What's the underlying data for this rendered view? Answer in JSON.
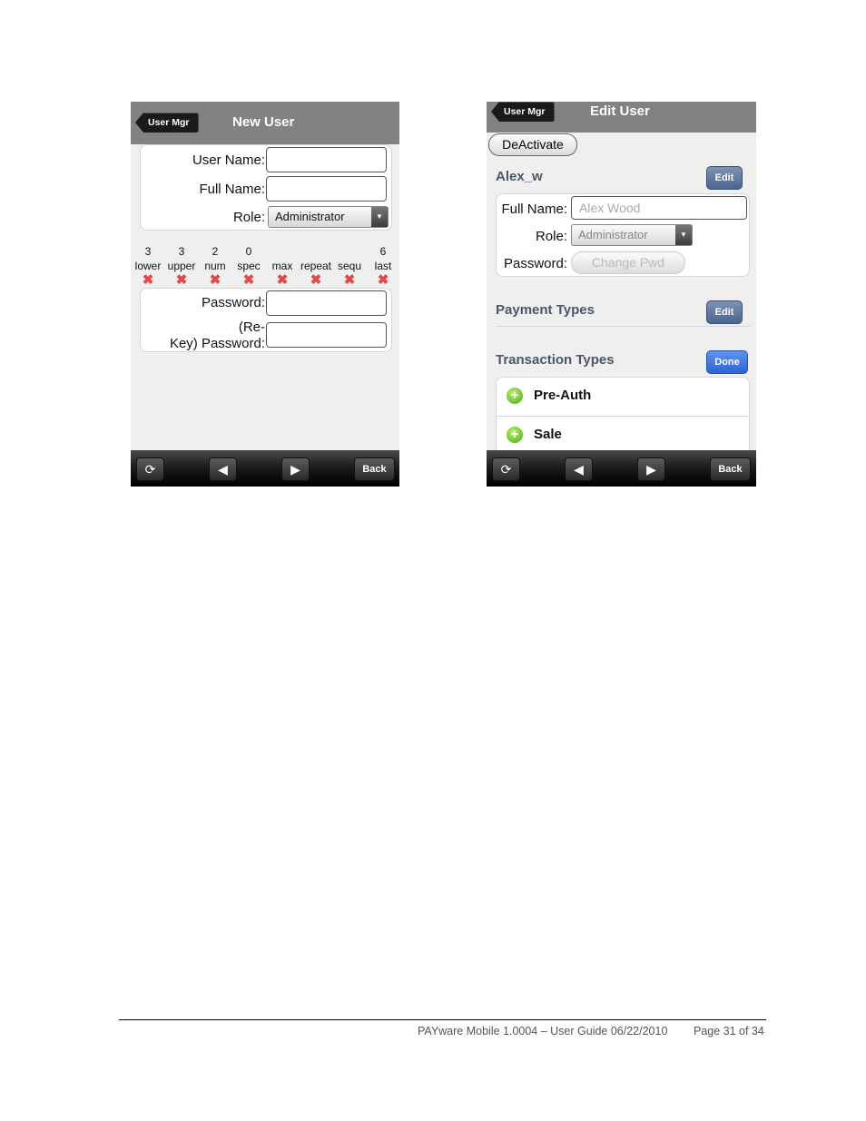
{
  "left": {
    "nav_back": "User Mgr",
    "title": "New User",
    "fields": {
      "username_label": "User Name:",
      "fullname_label": "Full Name:",
      "role_label": "Role:",
      "role_value": "Administrator"
    },
    "requirements": [
      {
        "count": "3",
        "name": "lower"
      },
      {
        "count": "3",
        "name": "upper"
      },
      {
        "count": "2",
        "name": "num"
      },
      {
        "count": "0",
        "name": "spec"
      },
      {
        "count": "",
        "name": "max"
      },
      {
        "count": "",
        "name": "repeat"
      },
      {
        "count": "",
        "name": "sequ"
      },
      {
        "count": "6",
        "name": "last"
      }
    ],
    "password_label": "Password:",
    "rekey_label_1": "(Re-",
    "rekey_label_2": "Key) Password:",
    "toolbar": {
      "back": "Back"
    }
  },
  "right": {
    "nav_back": "User Mgr",
    "title": "Edit User",
    "deactivate": "DeActivate",
    "username": "Alex_w",
    "edit_label": "Edit",
    "fullname_label": "Full Name:",
    "fullname_placeholder": "Alex Wood",
    "role_label": "Role:",
    "role_value": "Administrator",
    "password_label": "Password:",
    "change_pwd": "Change Pwd",
    "payment_types": "Payment Types",
    "payment_edit": "Edit",
    "transaction_types": "Transaction Types",
    "done_label": "Done",
    "transactions": [
      "Pre-Auth",
      "Sale"
    ],
    "toolbar": {
      "back": "Back"
    }
  },
  "footer": {
    "doc": "PAYware Mobile 1.0004 – User Guide 06/22/2010",
    "page": "Page 31 of 34"
  },
  "colors": {
    "titlebar": "#828282",
    "section_text": "#4c566a",
    "edit_button": "#4a6591",
    "done_button": "#2e63d3"
  },
  "icons": [
    "refresh-icon",
    "arrow-left-icon",
    "arrow-right-icon",
    "cross-icon",
    "plus-circle-icon"
  ]
}
